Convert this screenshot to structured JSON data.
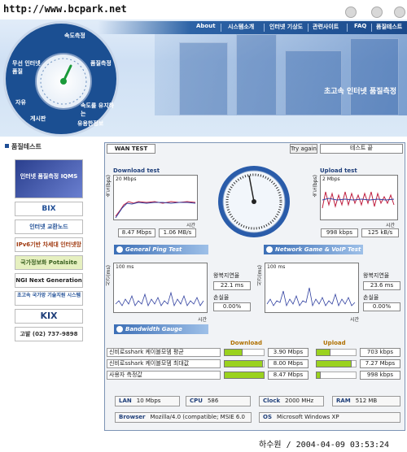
{
  "header": {
    "watermark": "http://www.bcpark.net",
    "menu": [
      "About",
      "시스템소개",
      "인터넷 기상도",
      "관련사이트",
      "FAQ",
      "품질테스트"
    ],
    "dial_labels": [
      "속도측정",
      "품질측정",
      "무선 인터넷 품질",
      "속도를 유지하는",
      "유용한정보",
      "게시판",
      "자유"
    ],
    "slogan": "초고속 인터넷 품질측정"
  },
  "sidebar": {
    "title": "품질테스트",
    "banners": [
      "인터넷 품질측정 IQMS",
      "BIX",
      "인터넷 교환노드",
      "IPv6기반 차세대 인터넷망",
      "국가정보화 Potalsite",
      "NGI Next Generation",
      "초고속 국가망 기술지원 시스템",
      "KIX",
      "고발 (02) 737-9898"
    ]
  },
  "main": {
    "tab": "WAN TEST",
    "try_again": "Try again",
    "status": "테스트 끝",
    "download": {
      "title": "Download test",
      "scale": "20 Mbps",
      "axis": "속도(bps)",
      "time": "시간",
      "values": [
        "8.47 Mbps",
        "1.06 MB/s"
      ]
    },
    "upload": {
      "title": "Upload test",
      "scale": "2 Mbps",
      "axis": "속도(bps)",
      "time": "시간",
      "values": [
        "998 kbps",
        "125 kB/s"
      ]
    },
    "ping": {
      "title": "General Ping Test",
      "scale": "100 ms",
      "axis": "시간(ms)",
      "time": "시간",
      "rtt_label": "왕복지연율",
      "rtt": "22.1 ms",
      "loss_label": "손실율",
      "loss": "0.00%"
    },
    "voip": {
      "title": "Network Game & VoIP Test",
      "scale": "100 ms",
      "axis": "시간(ms)",
      "time": "시간",
      "rtt_label": "왕복지연율",
      "rtt": "23.6 ms",
      "loss_label": "손실율",
      "loss": "0.00%"
    },
    "bandwidth": {
      "title": "Bandwidth Gauge",
      "download_label": "Download",
      "upload_label": "Upload",
      "rows": [
        {
          "label": "신비로sshark 케이블모뎀 평균",
          "down": "3.90 Mbps",
          "up": "703 kbps",
          "down_frac": 0.46,
          "up_frac": 0.36
        },
        {
          "label": "신비로sshark 케이블모뎀 최대값",
          "down": "8.00 Mbps",
          "up": "7.27 Mbps",
          "down_frac": 0.95,
          "up_frac": 0.88
        },
        {
          "label": "사용자 측정값",
          "down": "8.47 Mbps",
          "up": "998 kbps",
          "down_frac": 1.0,
          "up_frac": 0.12
        }
      ]
    },
    "info": {
      "lan_label": "LAN",
      "lan": "10 Mbps",
      "cpu_label": "CPU",
      "cpu": "586",
      "clock_label": "Clock",
      "clock": "2000 MHz",
      "ram_label": "RAM",
      "ram": "512 MB",
      "browser_label": "Browser",
      "browser": "Mozilla/4.0 (compatible; MSIE 6.0",
      "os_label": "OS",
      "os": "Microsoft Windows XP"
    }
  },
  "caption": "하수원 / 2004-04-09 03:53:24",
  "colors": {
    "accent": "#1f4e96",
    "bar": "#9ad21e",
    "download_line": "#3040a0",
    "upload_line": "#c02040"
  }
}
